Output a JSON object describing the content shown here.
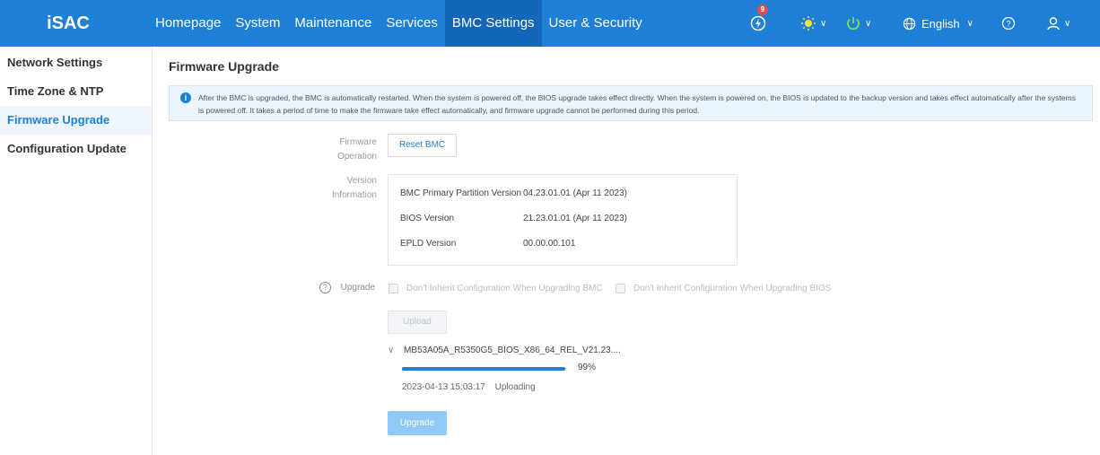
{
  "app": {
    "logo": "iSAC"
  },
  "nav": [
    "Homepage",
    "System",
    "Maintenance",
    "Services",
    "BMC Settings",
    "User & Security"
  ],
  "toolbar": {
    "alarm_count": "9",
    "language": "English"
  },
  "sidebar": {
    "items": [
      {
        "label": "Network Settings"
      },
      {
        "label": "Time Zone & NTP"
      },
      {
        "label": "Firmware Upgrade"
      },
      {
        "label": "Configuration Update"
      }
    ]
  },
  "page": {
    "title": "Firmware Upgrade",
    "notice": "After the BMC is upgraded, the BMC is automatically restarted. When the system is powered off, the BIOS upgrade takes effect directly. When the system is powered on, the BIOS is updated to the backup version and takes effect automatically after the systems is powered off. It takes a period of time to make the firmware take effect automatically, and firmware upgrade cannot be performed during this period.",
    "firmware_operation": {
      "label_line1": "Firmware",
      "label_line2": "Operation",
      "button": "Reset BMC"
    },
    "version_info": {
      "label_line1": "Version",
      "label_line2": "Information",
      "rows": [
        {
          "name": "BMC Primary Partition Version",
          "value": "04.23.01.01  (Apr 11 2023)"
        },
        {
          "name": "BIOS Version",
          "value": "21.23.01.01  (Apr 11 2023)"
        },
        {
          "name": "EPLD Version",
          "value": "00.00.00.101"
        }
      ]
    },
    "upgrade": {
      "label": "Upgrade",
      "option_bmc": "Don't Inherit Configuration When Upgrading BMC",
      "option_bios": "Don't Inherit Configuration When Upgrading BIOS",
      "upload_button": "Upload",
      "file": {
        "name": "MB53A05A_R5350G5_BIOS_X86_64_REL_V21.23....",
        "progress_percent": 99,
        "progress_label": "99%",
        "timestamp": "2023-04-13 15:03:17",
        "state": "Uploading"
      },
      "upgrade_button": "Upgrade"
    }
  },
  "colors": {
    "brand": "#1e7fd6",
    "nav_active": "#1467b8",
    "notice_bg": "#e9f4fe",
    "upgrade_btn": "#90c9f4"
  }
}
